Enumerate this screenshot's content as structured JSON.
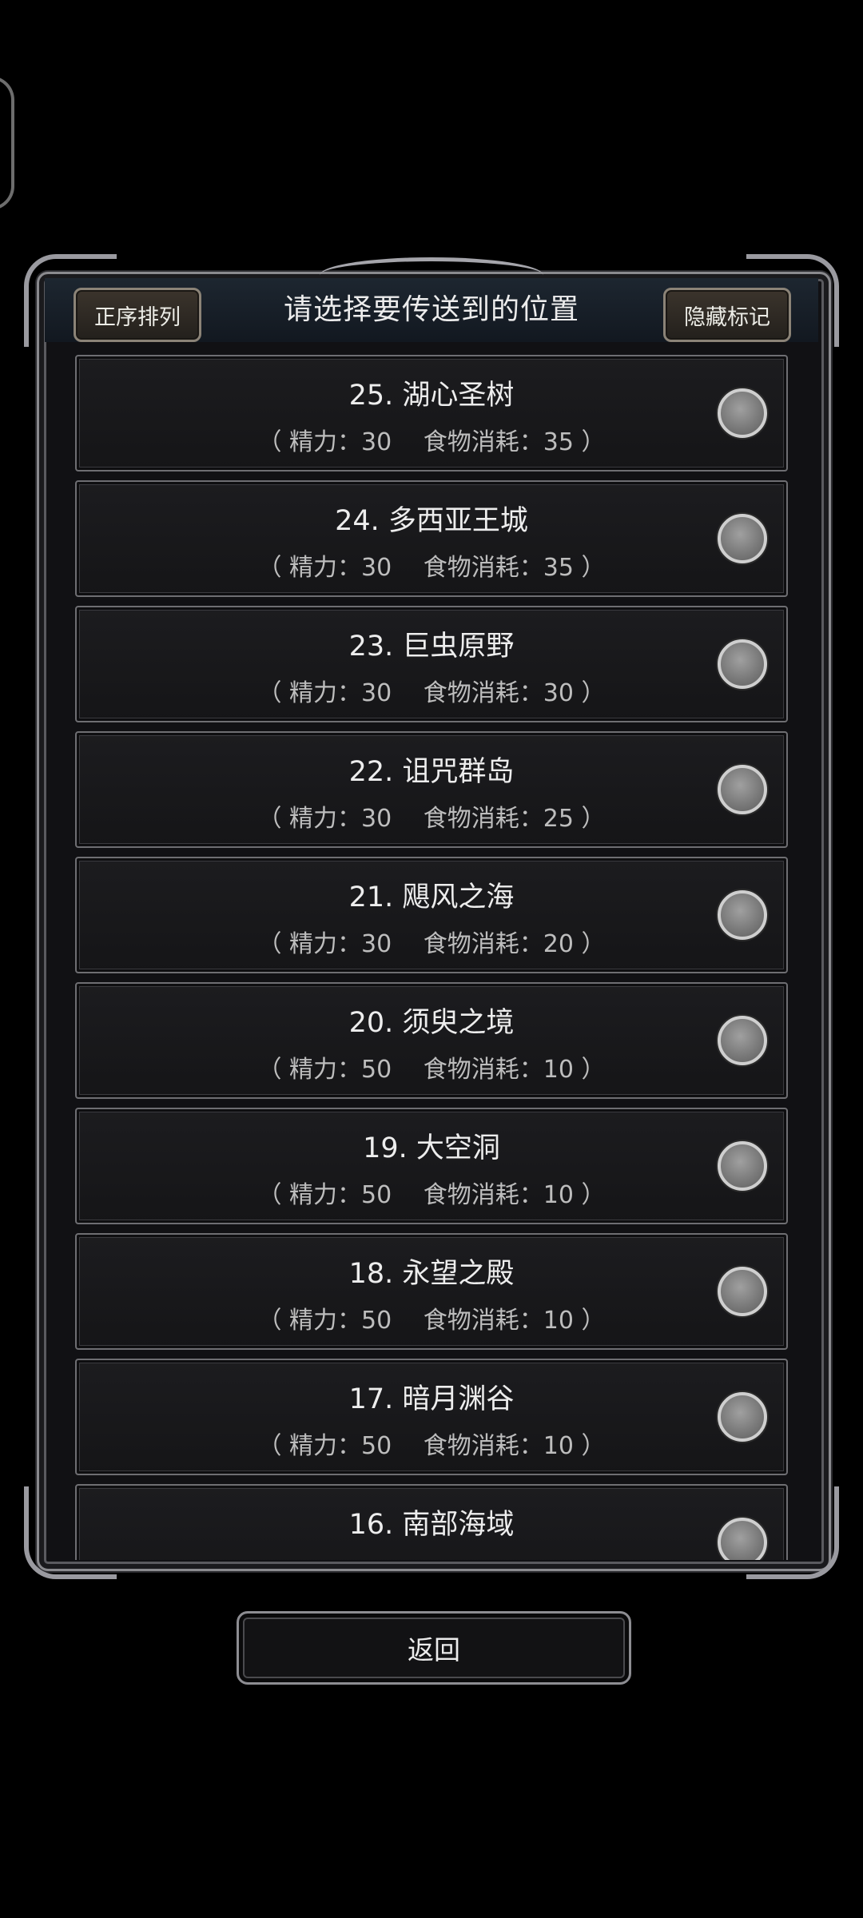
{
  "dialog": {
    "title": "请选择要传送到的位置",
    "sort_button_label": "正序排列",
    "hide_marks_button_label": "隐藏标记"
  },
  "locations": [
    {
      "name": "25. 湖心圣树",
      "cost": "（ 精力：30　 食物消耗：35 ）"
    },
    {
      "name": "24. 多西亚王城",
      "cost": "（ 精力：30　 食物消耗：35 ）"
    },
    {
      "name": "23. 巨虫原野",
      "cost": "（ 精力：30　 食物消耗：30 ）"
    },
    {
      "name": "22. 诅咒群岛",
      "cost": "（ 精力：30　 食物消耗：25 ）"
    },
    {
      "name": "21. 飓风之海",
      "cost": "（ 精力：30　 食物消耗：20 ）"
    },
    {
      "name": "20. 须臾之境",
      "cost": "（ 精力：50　 食物消耗：10 ）"
    },
    {
      "name": "19. 大空洞",
      "cost": "（ 精力：50　 食物消耗：10 ）"
    },
    {
      "name": "18. 永望之殿",
      "cost": "（ 精力：50　 食物消耗：10 ）"
    },
    {
      "name": "17. 暗月渊谷",
      "cost": "（ 精力：50　 食物消耗：10 ）"
    },
    {
      "name": "16. 南部海域",
      "cost": ""
    }
  ],
  "back_button_label": "返回"
}
